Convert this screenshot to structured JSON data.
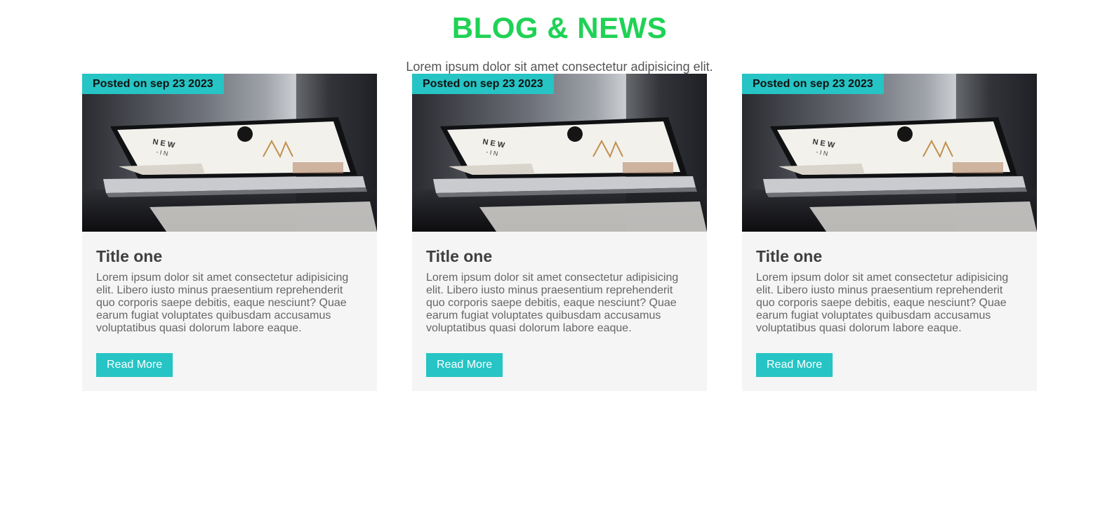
{
  "page": {
    "heading": "BLOG & NEWS",
    "subtitle": "Lorem ipsum dolor sit amet consectetur adipisicing elit."
  },
  "colors": {
    "heading": "#1fd255",
    "accent": "#26c4c4",
    "card_background": "#f5f5f5",
    "text": "#666666"
  },
  "cards": [
    {
      "badge": "Posted on sep 23 2023",
      "title": "Title one",
      "text": "Lorem ipsum dolor sit amet consectetur adipisicing elit. Libero iusto minus praesentium reprehenderit quo corporis saepe debitis, eaque nesciunt? Quae earum fugiat voluptates quibusdam accusamus voluptatibus quasi dolorum labore eaque.",
      "button": "Read More",
      "image": "laptop-photo"
    },
    {
      "badge": "Posted on sep 23 2023",
      "title": "Title one",
      "text": "Lorem ipsum dolor sit amet consectetur adipisicing elit. Libero iusto minus praesentium reprehenderit quo corporis saepe debitis, eaque nesciunt? Quae earum fugiat voluptates quibusdam accusamus voluptatibus quasi dolorum labore eaque.",
      "button": "Read More",
      "image": "laptop-photo"
    },
    {
      "badge": "Posted on sep 23 2023",
      "title": "Title one",
      "text": "Lorem ipsum dolor sit amet consectetur adipisicing elit. Libero iusto minus praesentium reprehenderit quo corporis saepe debitis, eaque nesciunt? Quae earum fugiat voluptates quibusdam accusamus voluptatibus quasi dolorum labore eaque.",
      "button": "Read More",
      "image": "laptop-photo"
    }
  ]
}
